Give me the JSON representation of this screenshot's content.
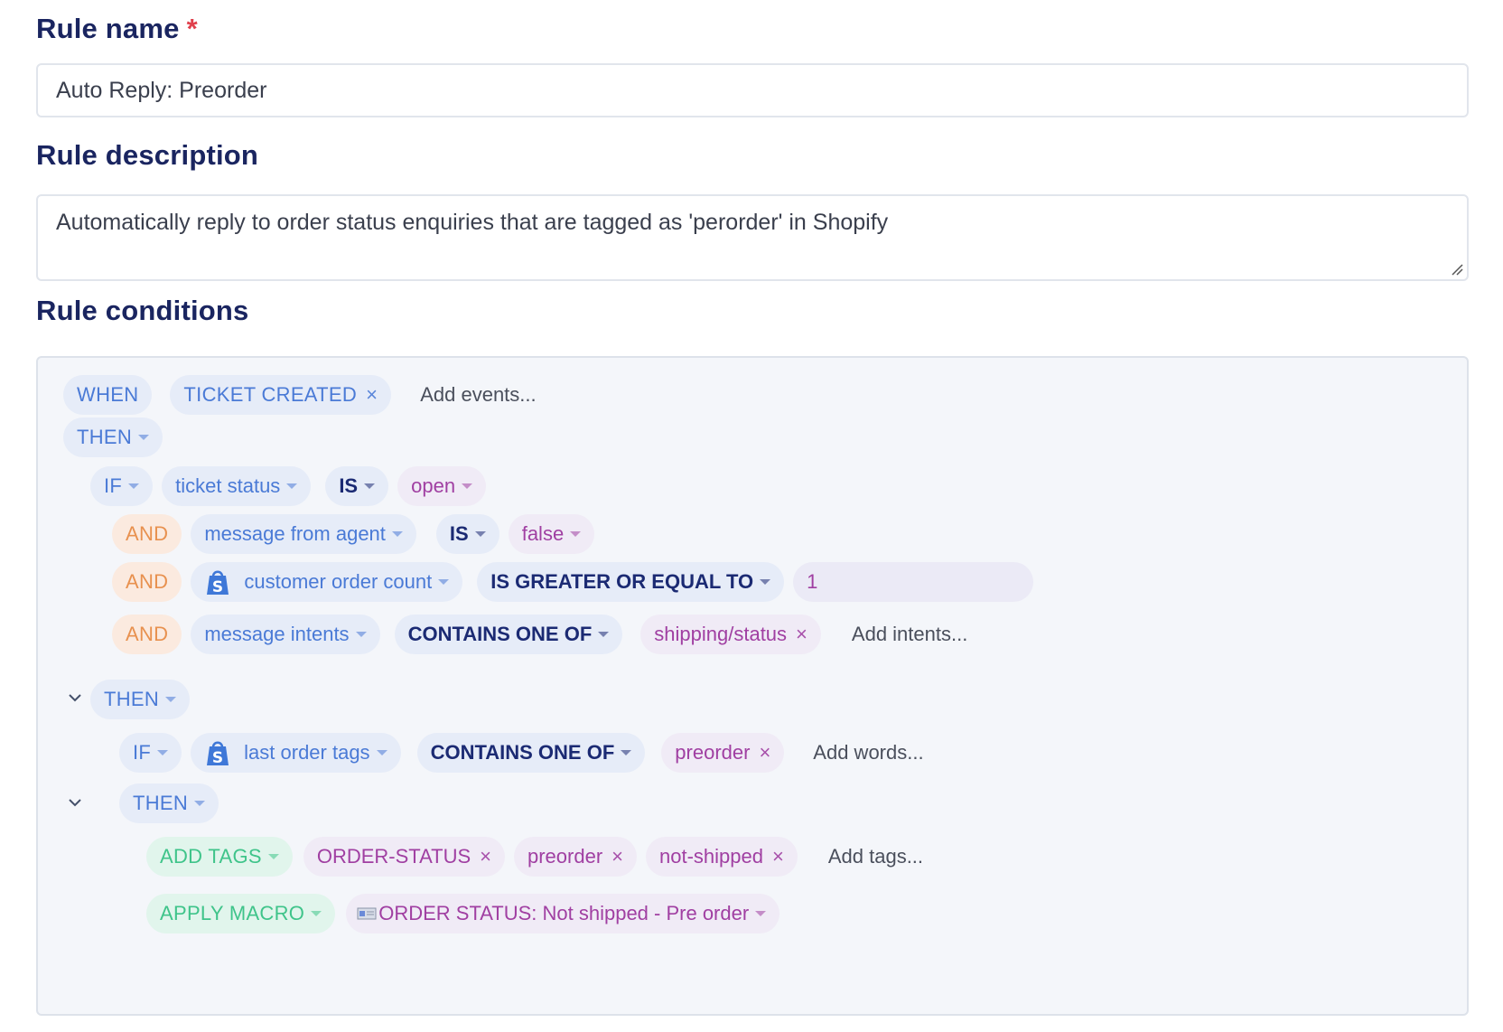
{
  "form": {
    "rule_name_label": "Rule name",
    "required_mark": "*",
    "rule_name_value": "Auto Reply: Preorder",
    "rule_description_label": "Rule description",
    "rule_description_value": "Automatically reply to order status enquiries that are tagged as 'perorder' in Shopify",
    "rule_conditions_label": "Rule conditions"
  },
  "conditions": {
    "when": {
      "keyword": "WHEN",
      "event": "TICKET CREATED",
      "add_placeholder": "Add events..."
    },
    "then1": "THEN",
    "if1": {
      "keyword": "IF",
      "field": "ticket status",
      "operator": "IS",
      "value": "open"
    },
    "and1": {
      "keyword": "AND",
      "field": "message from agent",
      "operator": "IS",
      "value": "false"
    },
    "and2": {
      "keyword": "AND",
      "field": "customer order count",
      "operator": "IS GREATER OR EQUAL TO",
      "value": "1"
    },
    "and3": {
      "keyword": "AND",
      "field": "message intents",
      "operator": "CONTAINS ONE OF",
      "value": "shipping/status",
      "add_placeholder": "Add intents..."
    },
    "then2": "THEN",
    "if2": {
      "keyword": "IF",
      "field": "last order tags",
      "operator": "CONTAINS ONE OF",
      "value": "preorder",
      "add_placeholder": "Add words..."
    },
    "then3": "THEN",
    "add_tags": {
      "keyword": "ADD TAGS",
      "tags": [
        "ORDER-STATUS",
        "preorder",
        "not-shipped"
      ],
      "add_placeholder": "Add tags..."
    },
    "apply_macro": {
      "keyword": "APPLY MACRO",
      "macro": "ORDER STATUS: Not shipped - Pre order"
    }
  },
  "colors": {
    "heading": "#1a2560",
    "blue_chip": "#4a7ad6",
    "operator": "#1b2a73",
    "and_chip": "#e8914f",
    "value_chip": "#a03fa2",
    "action_chip": "#3fc48a"
  },
  "icons": [
    "shopify-icon",
    "chevron-down-icon",
    "caret-down-icon",
    "remove-icon",
    "macro-emoji-icon",
    "resize-handle-icon"
  ]
}
